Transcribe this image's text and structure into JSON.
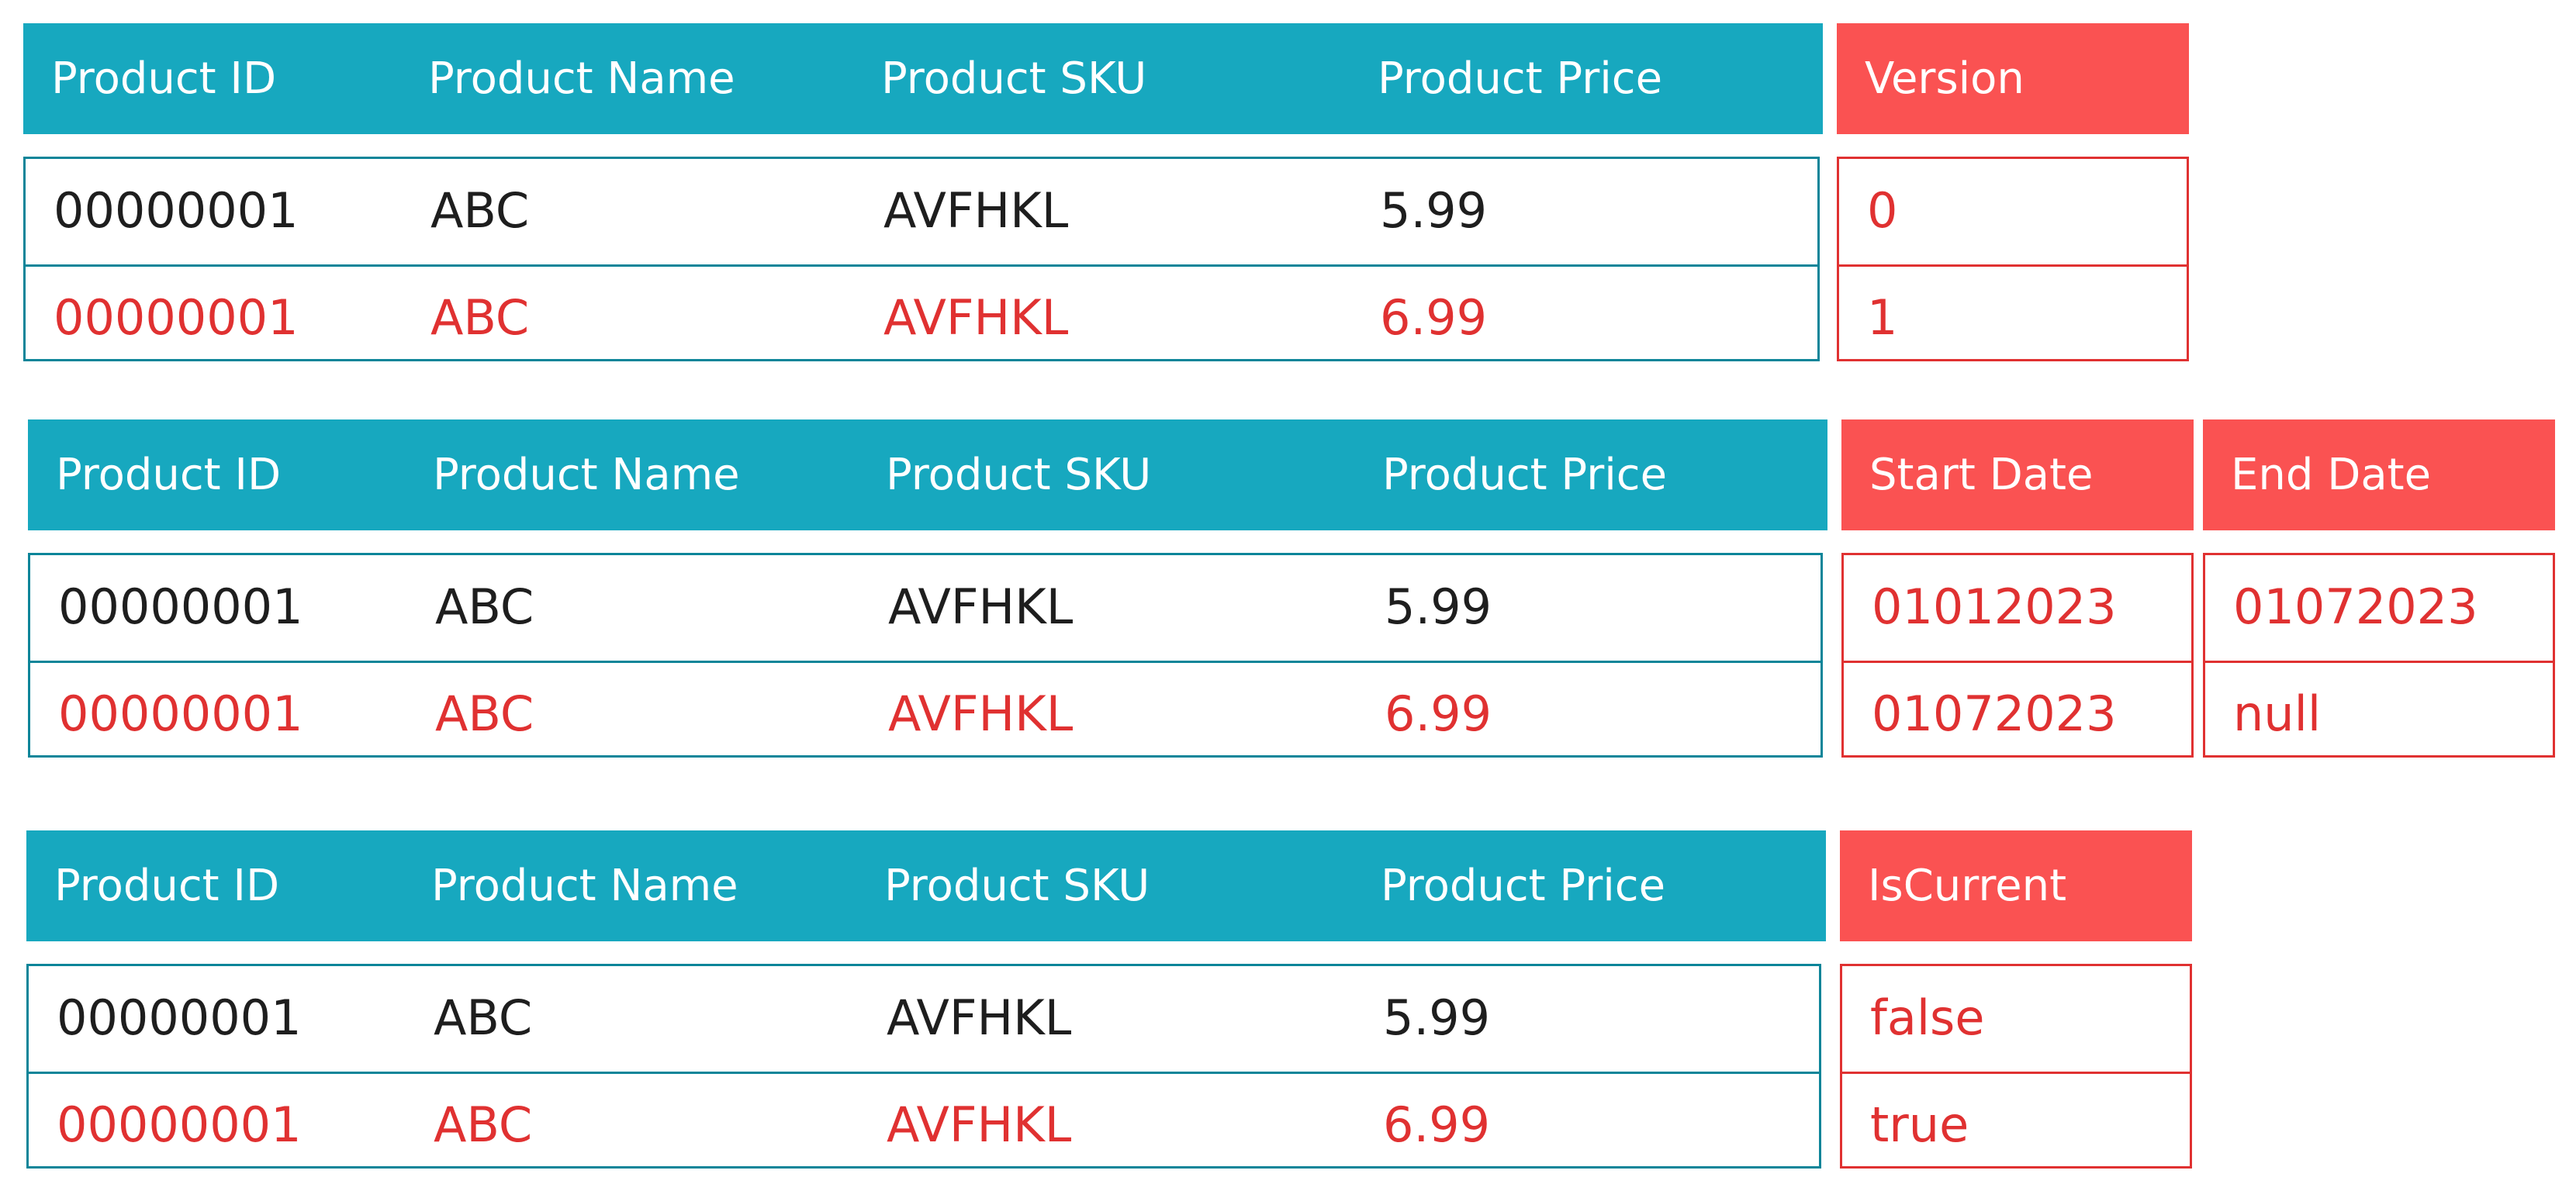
{
  "columns": {
    "id": "Product ID",
    "name": "Product Name",
    "sku": "Product SKU",
    "price": "Product Price"
  },
  "rows": [
    {
      "id": "00000001",
      "name": "ABC",
      "sku": "AVFHKL",
      "price": "5.99"
    },
    {
      "id": "00000001",
      "name": "ABC",
      "sku": "AVFHKL",
      "price": "6.99"
    }
  ],
  "version_table": {
    "header": "Version",
    "values": [
      "0",
      "1"
    ]
  },
  "date_table": {
    "start_header": "Start Date",
    "end_header": "End Date",
    "start_values": [
      "01012023",
      "01072023"
    ],
    "end_values": [
      "01072023",
      "null"
    ]
  },
  "current_table": {
    "header": "IsCurrent",
    "values": [
      "false",
      "true"
    ]
  },
  "colors": {
    "header_teal": "#17a8bf",
    "header_red": "#fa5252",
    "border_teal": "#0c8599",
    "highlight_red": "#e03131",
    "text_dark": "#1e1e1e"
  }
}
